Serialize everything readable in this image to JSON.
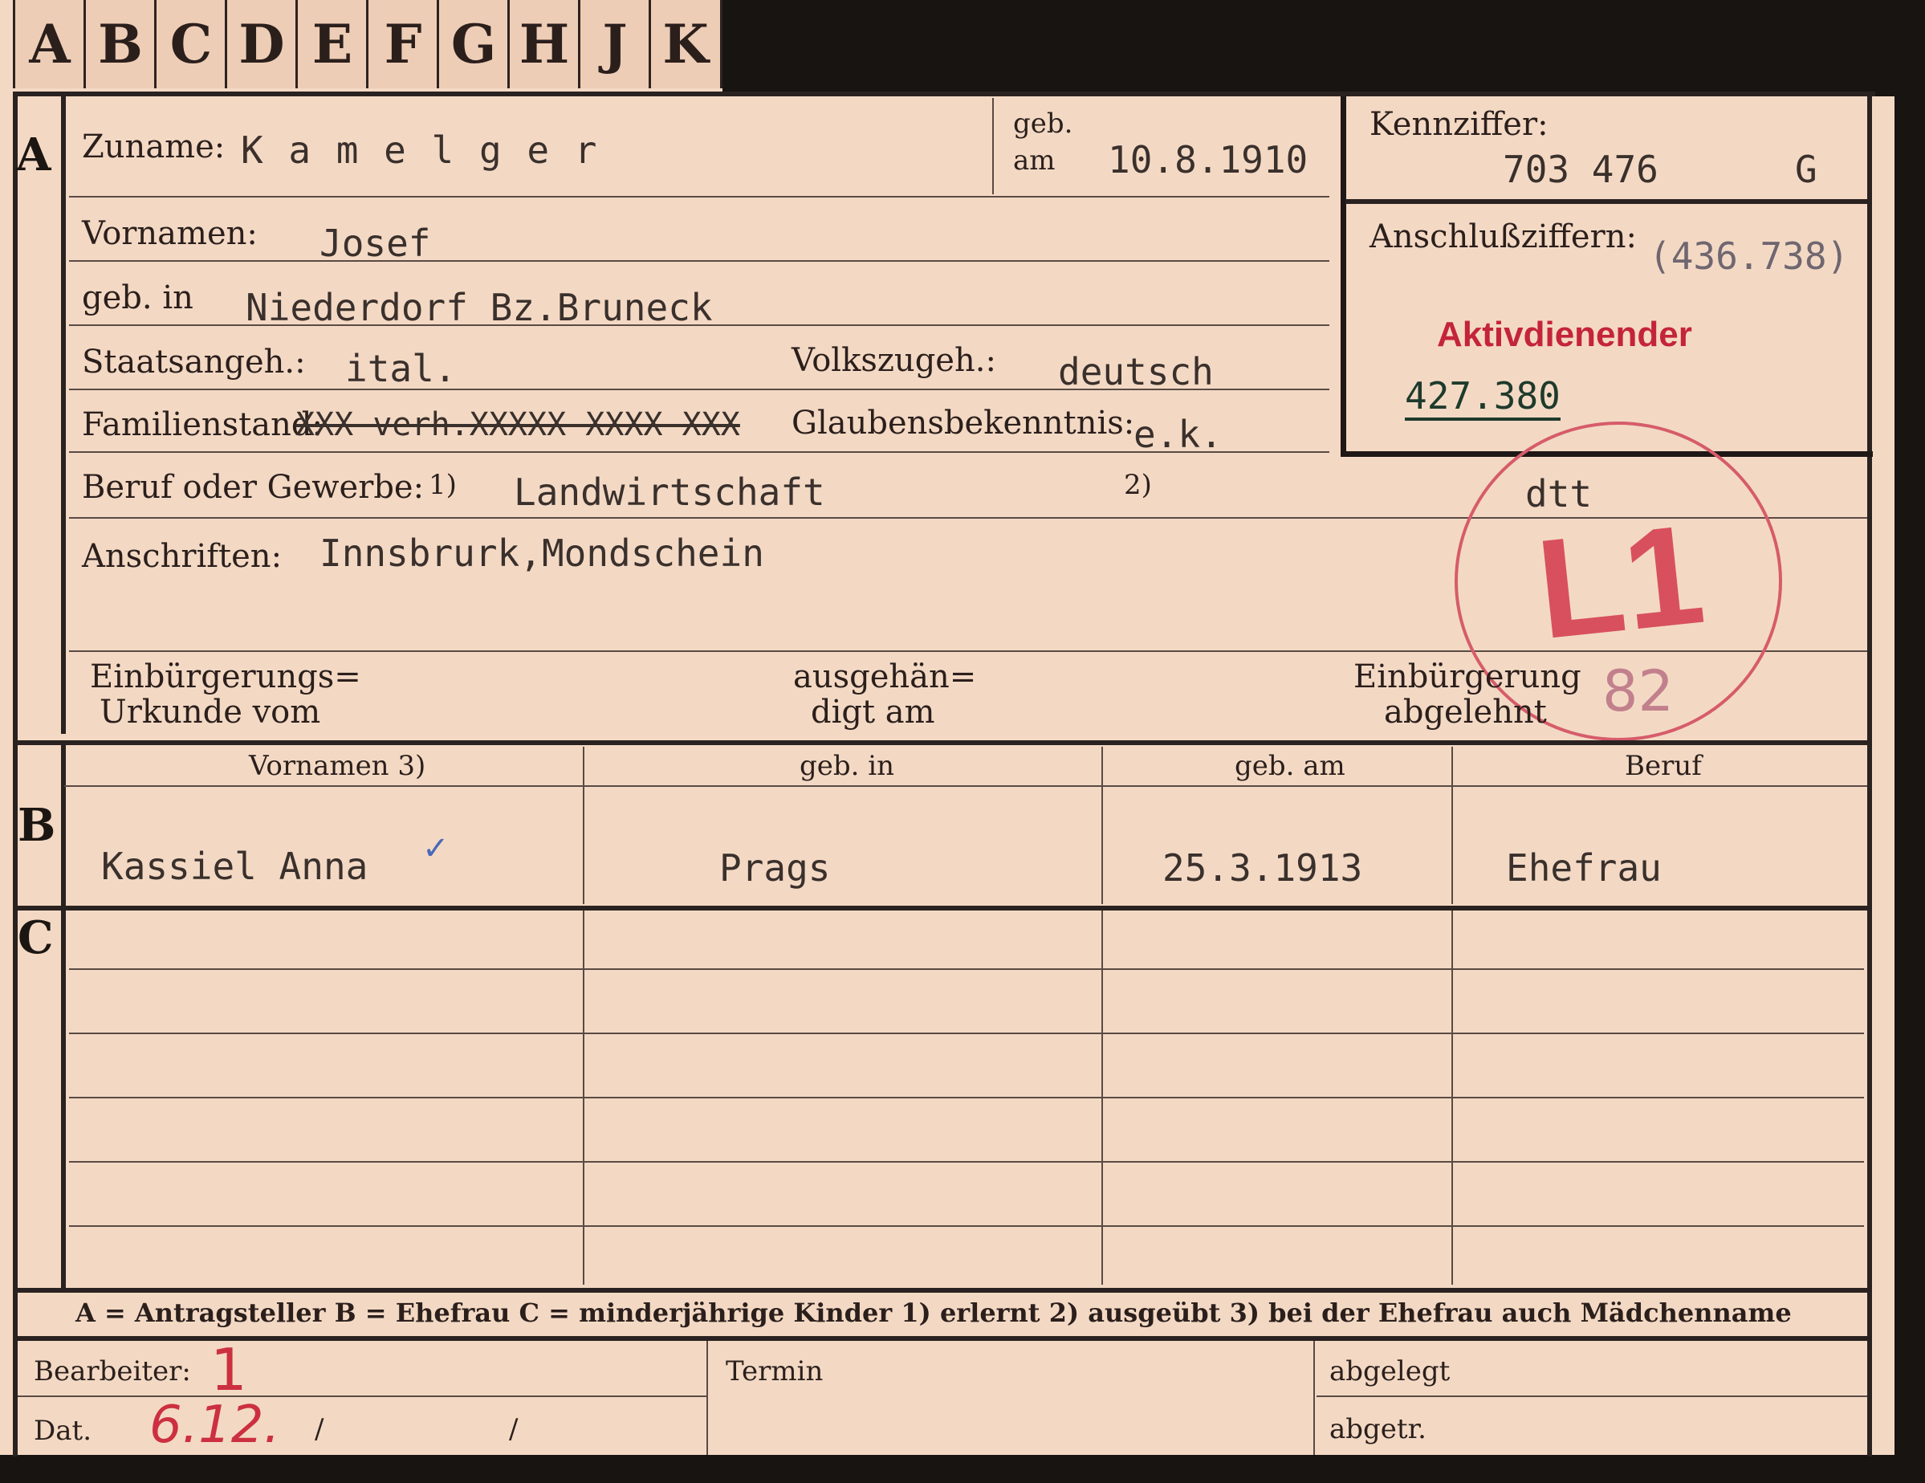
{
  "tabs": [
    "A",
    "B",
    "C",
    "D",
    "E",
    "F",
    "G",
    "H",
    "J",
    "K"
  ],
  "sections": {
    "a": "A",
    "b": "B",
    "c": "C"
  },
  "person": {
    "zuname_label": "Zuname:",
    "zuname": "K a m e l g e r",
    "geb_label_1": "geb.",
    "geb_label_2": "am",
    "geb_am": "10.8.1910",
    "vornamen_label": "Vornamen:",
    "vornamen": "Josef",
    "gebin_label": "geb. in",
    "geb_in": "Niederdorf Bz.Bruneck",
    "staat_label": "Staatsangeh.:",
    "staat": "ital.",
    "volk_label": "Volkszugeh.:",
    "volk": "deutsch",
    "familie_label": "Familienstand:",
    "familie": "XXX verh.XXXXX XXXX XXX",
    "glaube_label": "Glaubensbekenntnis:",
    "glaube": "e.k.",
    "beruf_label": "Beruf oder Gewerbe:",
    "footnote_1": "1)",
    "footnote_2": "2)",
    "beruf": "Landwirtschaft",
    "anschrift_label": "Anschriften:",
    "anschrift": "Innsbrurk,Mondschein"
  },
  "kennziffer": {
    "label": "Kennziffer:",
    "value": "703 476",
    "suffix": "G",
    "anschluss_label": "Anschlußziffern:",
    "anschluss_value": "(436.738)",
    "stamp": "Aktivdienender",
    "number": "427.380"
  },
  "stamp": {
    "dtt": "dtt",
    "code": "L1",
    "number": "82"
  },
  "einbuergerung": {
    "urkunde_l1": "Einbürgerungs=",
    "urkunde_l2": "Urkunde vom",
    "ausgehaendigt_l1": "ausgehän=",
    "ausgehaendigt_l2": "digt am",
    "abgelehnt_l1": "Einbürgerung",
    "abgelehnt_l2": "abgelehnt"
  },
  "table_b": {
    "headers": [
      "Vornamen 3)",
      "geb. in",
      "geb. am",
      "Beruf"
    ],
    "row": [
      "Kassiel Anna",
      "Prags",
      "25.3.1913",
      "Ehefrau"
    ]
  },
  "legend": "A = Antragsteller   B = Ehefrau   C = minderjährige Kinder   1) erlernt   2) ausgeübt   3) bei der Ehefrau auch Mädchenname",
  "footer": {
    "bearbeiter_label": "Bearbeiter:",
    "bearbeiter_hand": "1",
    "dat_label": "Dat.",
    "dat_hand": "6.12.",
    "slash": "/",
    "termin_label": "Termin",
    "abgelegt_label": "abgelegt",
    "abgetr_label": "abgetr."
  }
}
